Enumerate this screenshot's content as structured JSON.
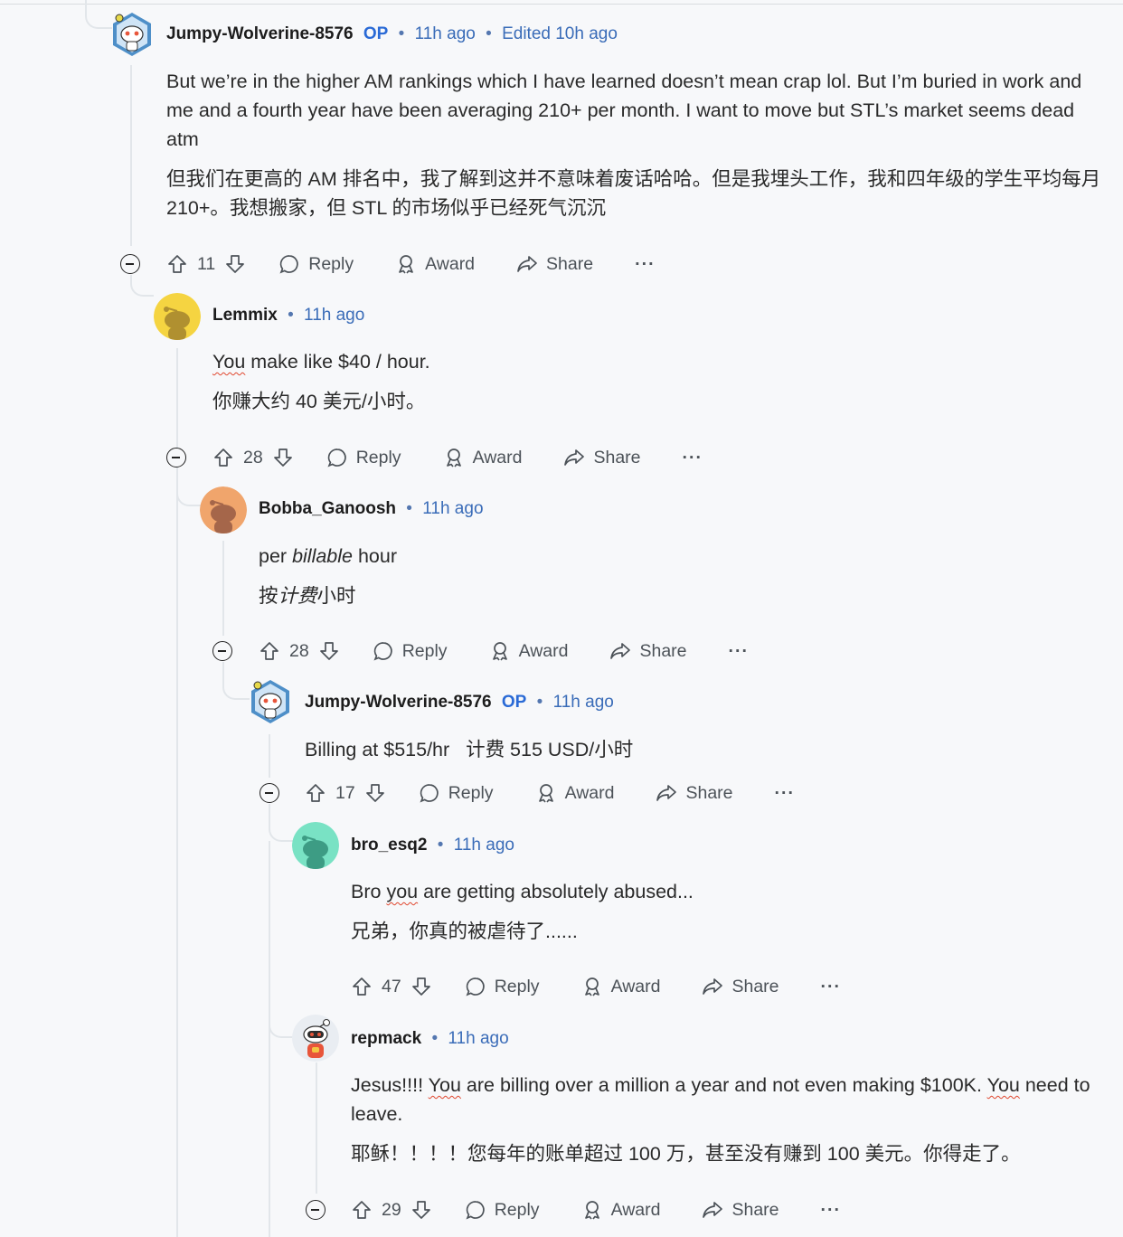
{
  "labels": {
    "op": "OP",
    "reply": "Reply",
    "award": "Award",
    "share": "Share",
    "more": "···"
  },
  "colors": {
    "author_link": "#3a6cb8",
    "op_badge": "#2a6ad6",
    "spellcheck": "#e0462e"
  },
  "comments": [
    {
      "author": "Jumpy-Wolverine-8576",
      "op": true,
      "time": "11h ago",
      "edited": "Edited 10h ago",
      "avatar": "snoo-white-blue-hex",
      "text_en": "But we’re in the higher AM rankings which I have learned doesn’t mean crap lol. But I’m buried in work and me and a fourth year have been averaging 210+ per month. I want to move but STL’s market seems dead atm",
      "text_zh": "但我们在更高的 AM 排名中，我了解到这并不意味着废话哈哈。但是我埋头工作，我和四年级的学生平均每月 210+。我想搬家，但 STL 的市场似乎已经死气沉沉",
      "votes": "11"
    },
    {
      "author": "Lemmix",
      "op": false,
      "time": "11h ago",
      "avatar": "snoo-yellow",
      "text_en_w1": "You",
      "text_en_rest": " make like $40 / hour.",
      "text_zh": "你赚大约 40 美元/小时。",
      "votes": "28"
    },
    {
      "author": "Bobba_Ganoosh",
      "op": false,
      "time": "11h ago",
      "avatar": "snoo-orange",
      "text_en_a": "per ",
      "text_en_b": "billable",
      "text_en_c": " hour",
      "text_zh_a": "按",
      "text_zh_b": "计费",
      "text_zh_c": "小时",
      "votes": "28"
    },
    {
      "author": "Jumpy-Wolverine-8576",
      "op": true,
      "time": "11h ago",
      "avatar": "snoo-white-blue-hex",
      "text_mixed": "Billing at $515/hr   计费 515 USD/小时",
      "votes": "17"
    },
    {
      "author": "bro_esq2",
      "op": false,
      "time": "11h ago",
      "avatar": "snoo-mint",
      "text_en_a": "Bro ",
      "text_en_b": "you",
      "text_en_c": " are getting absolutely abused...",
      "text_zh": "兄弟，你真的被虐待了......",
      "votes": "47"
    },
    {
      "author": "repmack",
      "op": false,
      "time": "11h ago",
      "avatar": "snoo-astronaut",
      "text_en_a": "Jesus!!!! ",
      "text_en_b": "You",
      "text_en_c": " are billing over a million a year and not even making $100K. ",
      "text_en_d": "You",
      "text_en_e": " need to leave.",
      "text_zh": "耶稣！！！！您每年的账单超过 100 万，甚至没有赚到 100 美元。你得走了。",
      "votes": "29"
    }
  ]
}
